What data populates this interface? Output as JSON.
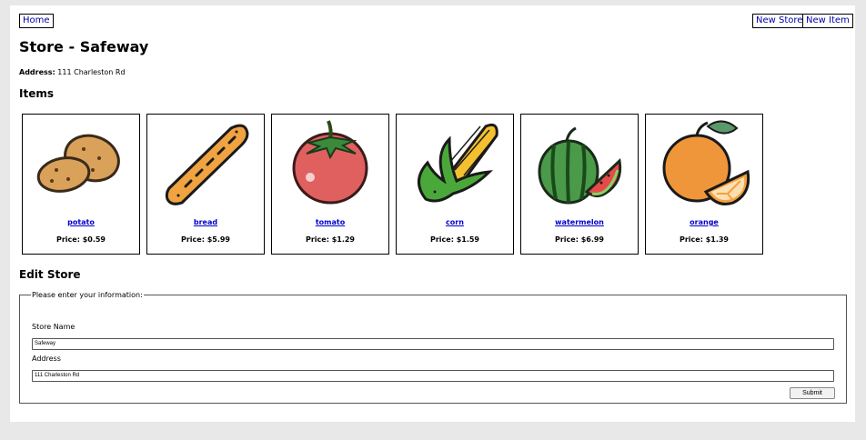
{
  "nav": {
    "home": "Home",
    "new_store": "New Store",
    "new_item": "New Item"
  },
  "store": {
    "title": "Store - Safeway",
    "address_label": "Address:",
    "address": "111 Charleston Rd"
  },
  "items_heading": "Items",
  "items": [
    {
      "name": "potato",
      "price": "Price: $0.59",
      "icon": "potato-icon"
    },
    {
      "name": "bread",
      "price": "Price: $5.99",
      "icon": "bread-icon"
    },
    {
      "name": "tomato",
      "price": "Price: $1.29",
      "icon": "tomato-icon"
    },
    {
      "name": "corn",
      "price": "Price: $1.59",
      "icon": "corn-icon"
    },
    {
      "name": "watermelon",
      "price": "Price: $6.99",
      "icon": "watermelon-icon"
    },
    {
      "name": "orange",
      "price": "Price: $1.39",
      "icon": "orange-icon"
    }
  ],
  "edit": {
    "heading": "Edit Store",
    "legend": "Please enter your information:",
    "store_name_label": "Store Name",
    "store_name_value": "Safeway",
    "address_label": "Address",
    "address_value": "111 Charleston Rd",
    "submit": "Submit"
  }
}
